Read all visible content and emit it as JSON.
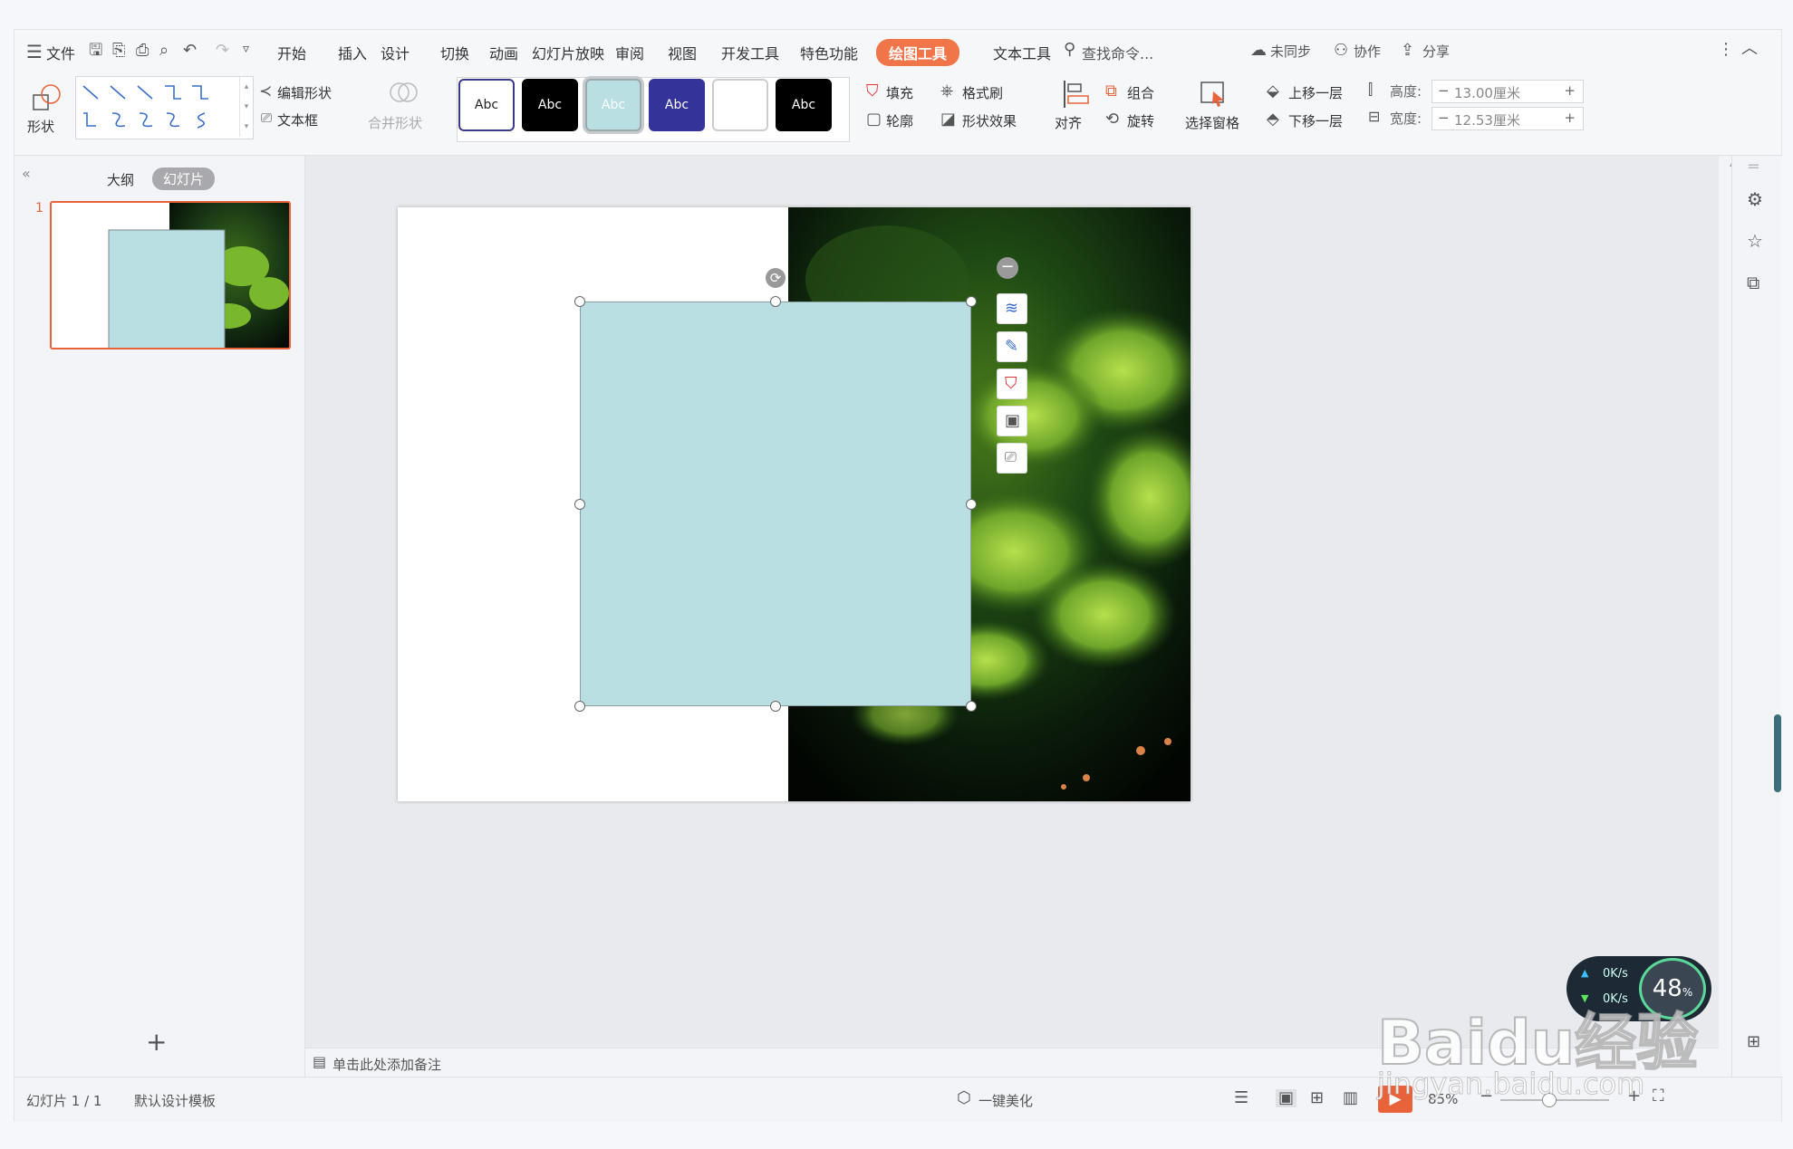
{
  "menubar": {
    "file_label": "文件",
    "tabs": [
      "开始",
      "插入",
      "设计",
      "切换",
      "动画",
      "幻灯片放映",
      "审阅",
      "视图",
      "开发工具",
      "特色功能",
      "绘图工具",
      "文本工具"
    ],
    "active_tab": "绘图工具",
    "search_placeholder": "查找命令...",
    "sync_label": "未同步",
    "collab_label": "协作",
    "share_label": "分享"
  },
  "ribbon": {
    "shape_label": "形状",
    "edit_shape_label": "编辑形状",
    "textbox_label": "文本框",
    "merge_shape_label": "合并形状",
    "style_swatches": [
      {
        "text": "Abc",
        "bg": "#ffffff",
        "fg": "#222222",
        "border": "#3a3a8c"
      },
      {
        "text": "Abc",
        "bg": "#000000",
        "fg": "#ffffff",
        "border": "#000000"
      },
      {
        "text": "Abc",
        "bg": "#b9dfe2",
        "fg": "#ffffff",
        "border": "#9aa"
      },
      {
        "text": "Abc",
        "bg": "#33339a",
        "fg": "#ffffff",
        "border": "#33339a"
      },
      {
        "text": "",
        "bg": "#ffffff",
        "fg": "#222222",
        "border": "#cccccc"
      },
      {
        "text": "Abc",
        "bg": "#000000",
        "fg": "#ffffff",
        "border": "#000000"
      }
    ],
    "fill_label": "填充",
    "format_painter_label": "格式刷",
    "outline_label": "轮廓",
    "shape_effect_label": "形状效果",
    "align_label": "对齐",
    "group_label": "组合",
    "rotate_label": "旋转",
    "selection_pane_label": "选择窗格",
    "bring_forward_label": "上移一层",
    "send_backward_label": "下移一层",
    "height_label": "高度:",
    "height_value": "13.00厘米",
    "width_label": "宽度:",
    "width_value": "12.53厘米"
  },
  "leftpanel": {
    "outline_tab": "大纲",
    "slides_tab": "幻灯片",
    "slide_number": "1"
  },
  "canvas": {
    "notes_placeholder": "单击此处添加备注",
    "shape_fill": "#b9dfe2"
  },
  "statusbar": {
    "slide_count": "幻灯片 1 / 1",
    "template": "默认设计模板",
    "beautify": "一键美化",
    "zoom": "85%"
  },
  "overlay": {
    "net_up": "0K/s",
    "net_down": "0K/s",
    "percent": "48",
    "percent_unit": "%",
    "watermark_main": "Baidu经验",
    "watermark_url": "jingyan.baidu.com"
  },
  "colors": {
    "accent": "#f0764a",
    "selection_border": "#e8633a"
  }
}
